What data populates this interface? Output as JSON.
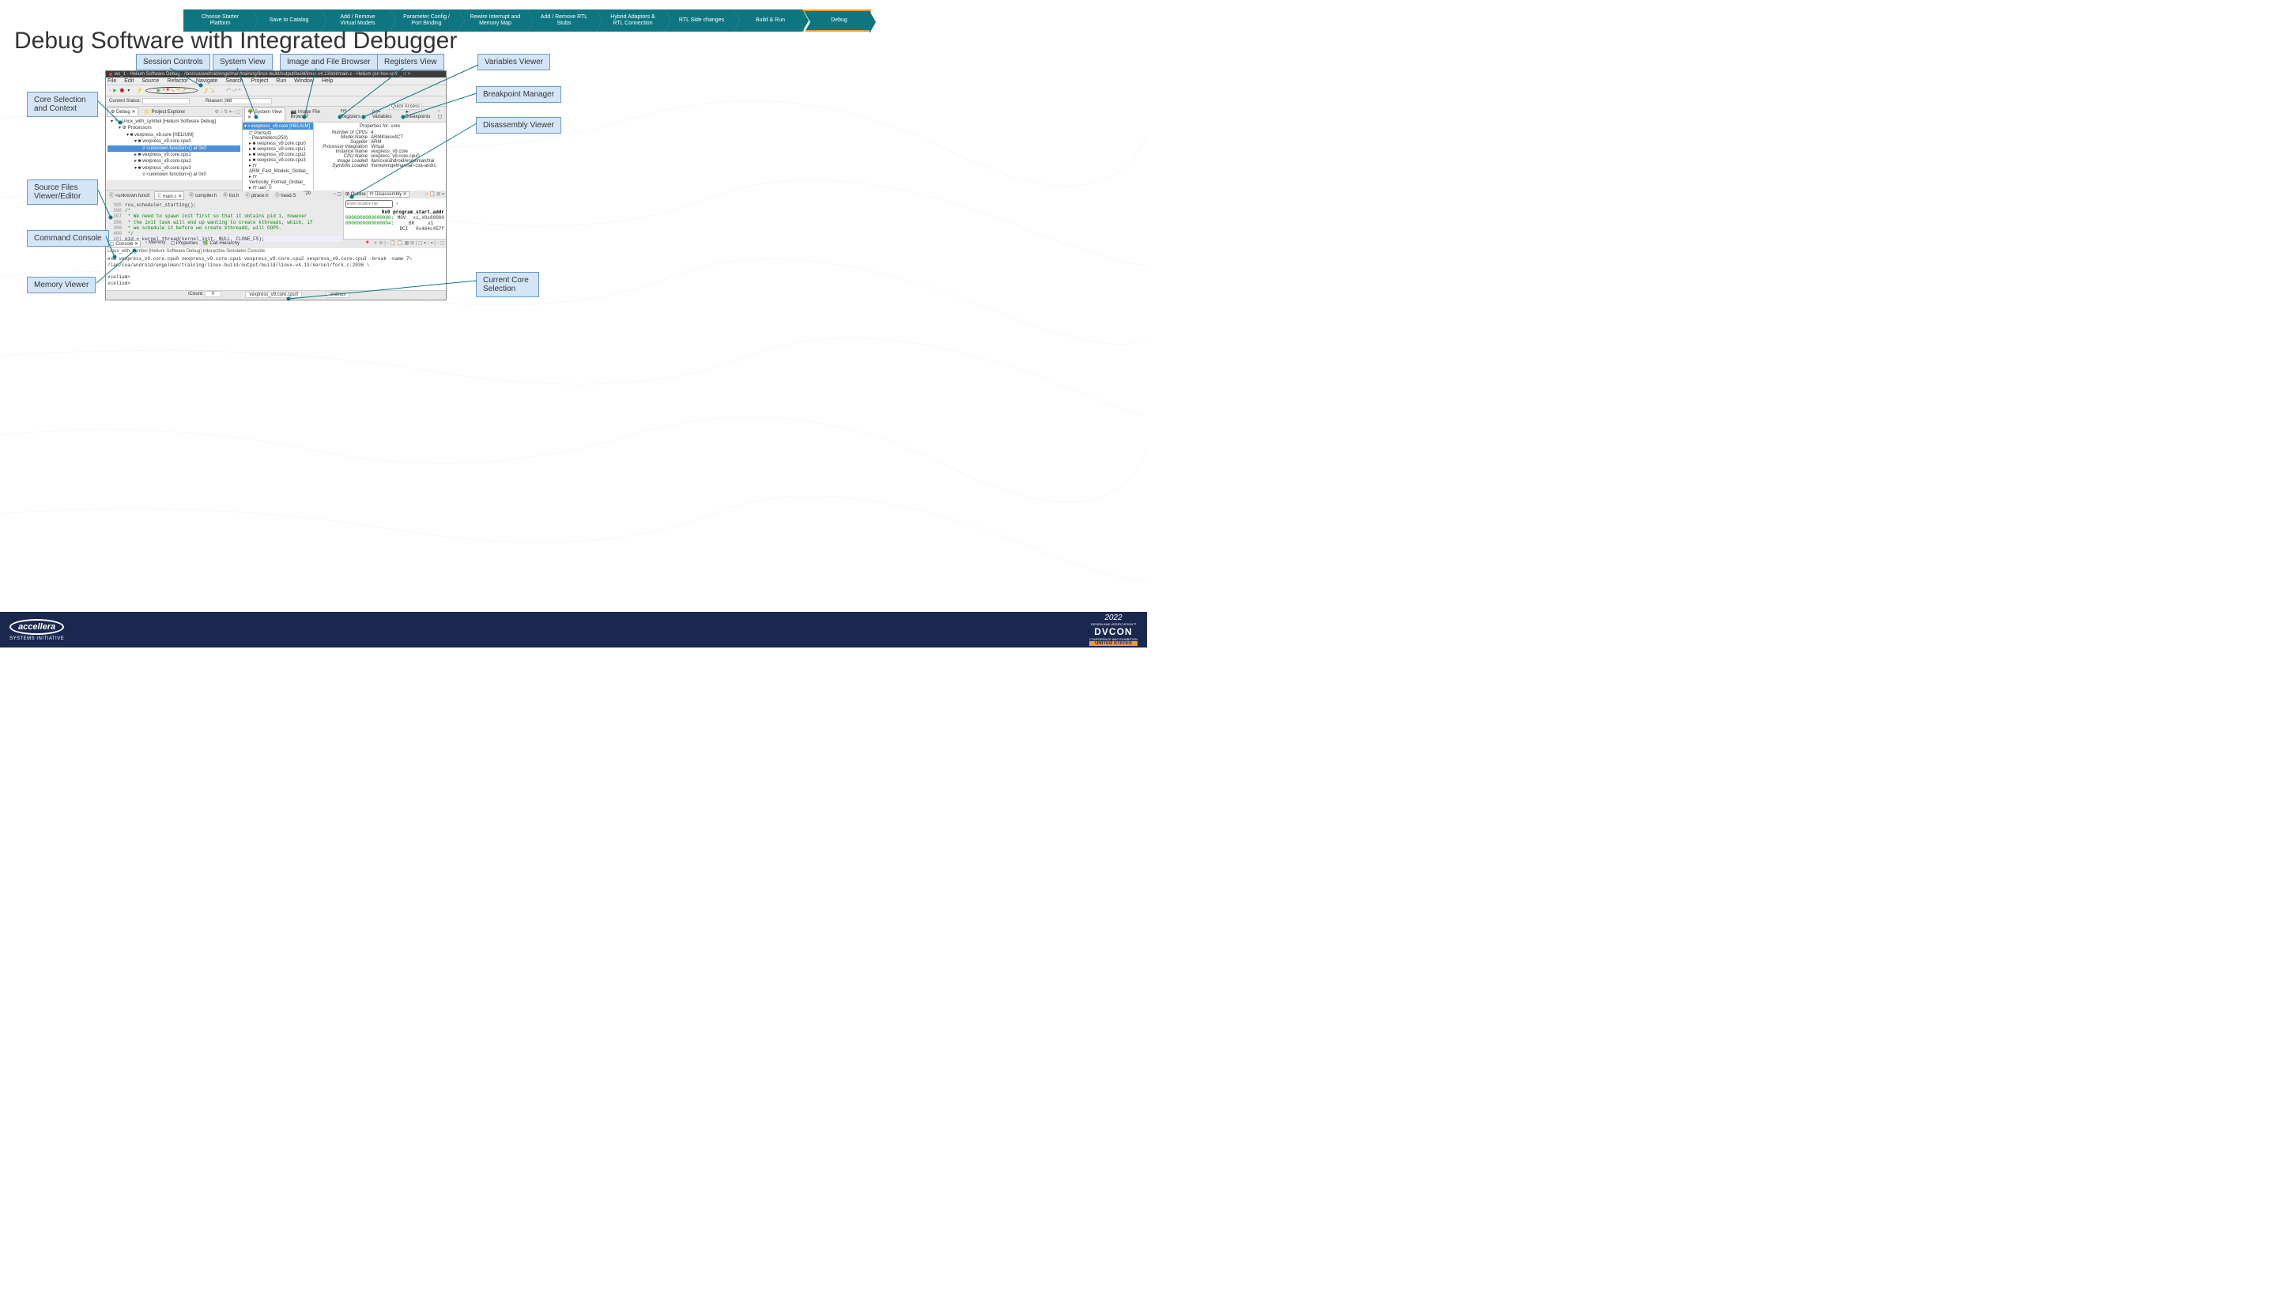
{
  "workflow": {
    "steps": [
      "Choose Starter Platform",
      "Save to Catalog",
      "Add / Remove Virtual Models",
      "Parameter Config / Port Binding",
      "Rewire Interrupt and Memory Map",
      "Add / Remove RTL Stubs",
      "Hybrid Adaptors & RTL Connection",
      "RTL Side changes",
      "Build & Run",
      "Debug"
    ],
    "active_index": 9
  },
  "slide_title": "Debug Software with Integrated Debugger",
  "callouts": {
    "session_controls": "Session Controls",
    "system_view": "System View",
    "image_file_browser": "Image and File Browser",
    "registers_view": "Registers View",
    "variables_viewer": "Variables Viewer",
    "core_selection": "Core Selection and Context",
    "breakpoint_manager": "Breakpoint Manager",
    "disassembly_viewer": "Disassembly Viewer",
    "source_files": "Source Files Viewer/Editor",
    "command_console": "Command Console",
    "memory_viewer": "Memory Viewer",
    "current_core": "Current Core Selection"
  },
  "ide": {
    "title": "ws_1 - Helium Software Debug - /lan/cva/android/engelman/training/linux-build/output/build/linux-v4.13/init/main.c - Helium   (on hsv-sc4:   _  □  ×",
    "menu": [
      "File",
      "Edit",
      "Source",
      "Refactor",
      "Navigate",
      "Search",
      "Project",
      "Run",
      "Window",
      "Help"
    ],
    "status": {
      "current_label": "Current Status:",
      "reason_label": "Reason:",
      "reason_value": "Init"
    },
    "quick_access": "Quick Access",
    "debug_pane": {
      "tabs": [
        "⚙ Debug ✕",
        "📁 Project Explorer"
      ],
      "tree": [
        {
          "lvl": 1,
          "text": "▾ 🔧 Linux_with_symbol [Helium Software Debug]"
        },
        {
          "lvl": 2,
          "text": "▾ ⚙ Processors"
        },
        {
          "lvl": 3,
          "text": "▾ ■ vexpress_v9.core [HELIUM]"
        },
        {
          "lvl": 4,
          "text": "▾ ■ vexpress_v9.core.cpu0"
        },
        {
          "lvl": 5,
          "text": "≡ <unknown function>() at 0x0",
          "selected": true
        },
        {
          "lvl": 4,
          "text": "▸ ■ vexpress_v9.core.cpu1"
        },
        {
          "lvl": 4,
          "text": "▸ ■ vexpress_v9.core.cpu2"
        },
        {
          "lvl": 4,
          "text": "▾ ■ vexpress_v9.core.cpu3"
        },
        {
          "lvl": 5,
          "text": "≡ <unknown function>() at 0x0"
        }
      ]
    },
    "sysview": {
      "tabs": [
        "🌳 System View ✕",
        "📷 Image File Browser",
        "⫯⫯⫯ Registers",
        "(x)= Variables",
        "●◦ Breakpoints"
      ],
      "tree_header": "▾ ▪ vexpress_v9.core [HELIUM]",
      "tree": [
        "⊏ Ports(4)",
        "▫ Parameters(250)",
        "▸ ■ vexpress_v9.core.cpu0",
        "▸ ■ vexpress_v9.core.cpu1",
        "▸ ■ vexpress_v9.core.cpu2",
        "▸ ■ vexpress_v9.core.cpu3",
        "▸ ⫯⫯ ARM_Fast_Models_Global_",
        "▸ ⫯⫯ Verbosity_Format_Global_",
        "▸ ⫯⫯ uart_0"
      ],
      "props_title": "Properties for: core",
      "props": [
        {
          "k": "Number of CPUs",
          "v": "4"
        },
        {
          "k": "Model Name",
          "v": "ARMKleinx4CT"
        },
        {
          "k": "Supplier",
          "v": "ARM"
        },
        {
          "k": "Processor Integration",
          "v": "Virtual"
        },
        {
          "k": "Instance Name",
          "v": "vexpress_v9.core"
        },
        {
          "k": "CPU Name",
          "v": "vexpress_v9.core.cpu0"
        },
        {
          "k": "Image Loaded",
          "v": "/lan/cva/android/engelman/trai"
        },
        {
          "k": "Symbols Loaded",
          "v": "/home/engelman/lan-cva-andrc"
        }
      ]
    },
    "editor": {
      "tabs": [
        "ⓒ <unknown functi",
        "ⓒ main.c ✕",
        "ⓗ compiler.h",
        "ⓗ list.h",
        "ⓒ ptrace.h",
        "ⓢ head.S"
      ],
      "extra": "\"20",
      "lines": [
        {
          "n": "395",
          "t": "rcu_scheduler_starting();",
          "cls": ""
        },
        {
          "n": "396",
          "t": "/*",
          "cls": "comment"
        },
        {
          "n": "397",
          "t": " * We need to spawn init first so that it obtains pid 1, however",
          "cls": "comment"
        },
        {
          "n": "398",
          "t": " * the init task will end up wanting to create kthreads, which, if",
          "cls": "comment"
        },
        {
          "n": "399",
          "t": " * we schedule it before we create kthreadd, will OOPS.",
          "cls": "comment"
        },
        {
          "n": "400",
          "t": " */",
          "cls": "comment"
        },
        {
          "n": "401",
          "t": "pid = kernel_thread(kernel_init, NULL, CLONE_FS);",
          "cls": "hl"
        }
      ]
    },
    "disasm": {
      "tabs": [
        "⊞ Outline",
        "⫯⫯ Disassembly ✕"
      ],
      "input_placeholder": "Enter location her",
      "header": "0x0 program_start_addr",
      "lines": [
        {
          "a": "0000000000000000:",
          "op": "MOV",
          "arg": "x1,#0x80000"
        },
        {
          "a": "0000000000000004:",
          "op": "BR",
          "arg": "x1"
        },
        {
          "a": "",
          "op": "DCI",
          "arg": "0x464c457f"
        }
      ]
    },
    "console": {
      "tabs": [
        "▢ Console ✕",
        "▫ Memory",
        "▢ Properties",
        "🌿 Call Hierarchy"
      ],
      "header": "Linux_with_symbol [Helium Software Debug] Interactive Simulator Console",
      "lines": [
        "esw vexpress_v9.core.cpu0 vexpress_v9.core.cpu1 vexpress_v9.core.cpu2 vexpress_v9.core.cpu3 -break -name 7\\",
        "/lan/cva/android/engelman/training/linux-build/output/build/linux-v4.13/kernel/fork.c:2036 \\",
        "",
        "xcelium>",
        "xcelium>"
      ]
    },
    "statusbar": {
      "icount_label": "ICount:",
      "icount_value": "0",
      "core": "vexpress_v9.core.cpu0",
      "image": "vmlinux"
    }
  },
  "footer": {
    "accellera": "accellera",
    "accellera_sub": "SYSTEMS INITIATIVE",
    "dvcon_year": "2022",
    "dvcon_tag1": "DESIGN AND VERIFICATION™",
    "dvcon_main": "DVCON",
    "dvcon_tag2": "CONFERENCE AND EXHIBITION",
    "dvcon_us": "UNITED STATES"
  }
}
